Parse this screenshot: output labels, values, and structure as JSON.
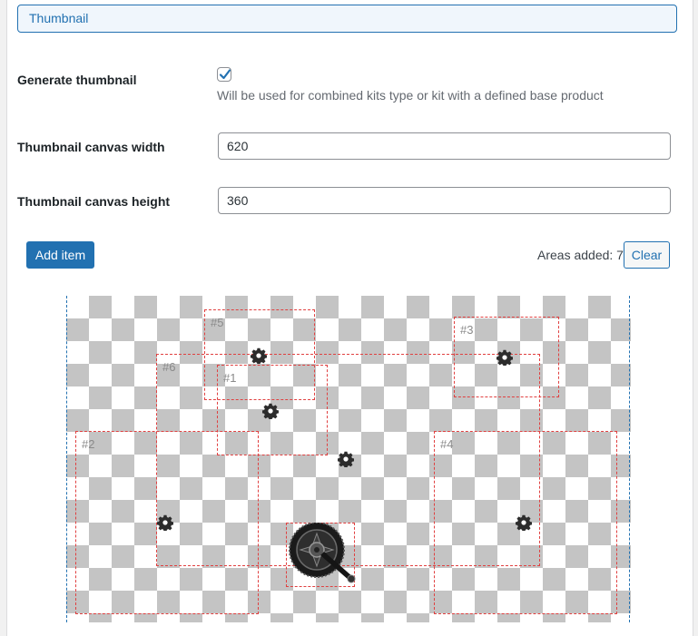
{
  "section": {
    "title": "Thumbnail"
  },
  "generate": {
    "label": "Generate thumbnail",
    "checked": true,
    "help": "Will be used for combined kits type or kit with a defined base product"
  },
  "width": {
    "label": "Thumbnail canvas width",
    "value": "620"
  },
  "height": {
    "label": "Thumbnail canvas height",
    "value": "360"
  },
  "actions": {
    "add_item": "Add item",
    "areas_added": "Areas added: 7",
    "clear": "Clear"
  },
  "canvas": {
    "areas": [
      {
        "label": "#5"
      },
      {
        "label": "#6"
      },
      {
        "label": "#1"
      },
      {
        "label": "#3"
      },
      {
        "label": "#2"
      },
      {
        "label": "#4"
      },
      {
        "label": ""
      }
    ],
    "settings_icon": "gear-icon",
    "item_image": "bicycle-crankset"
  }
}
